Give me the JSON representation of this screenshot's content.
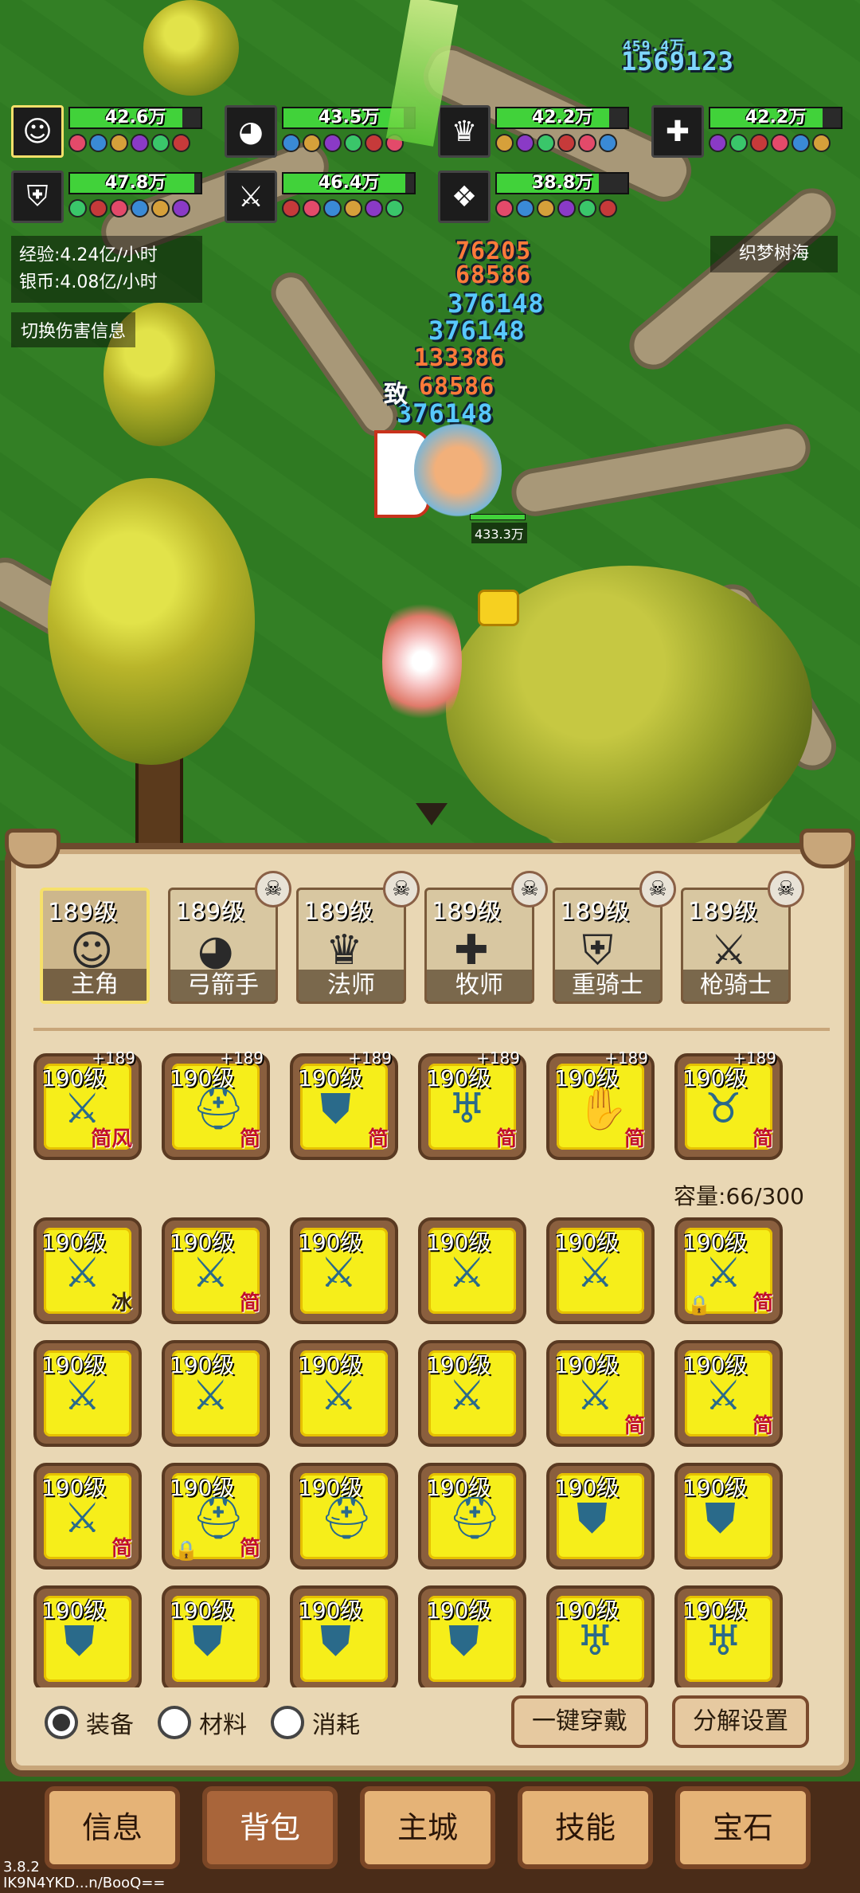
{
  "party": [
    {
      "hp": "42.6万",
      "icon": "hero-icon",
      "glyph": "☺",
      "fill": 0.86,
      "selected": true
    },
    {
      "hp": "43.5万",
      "icon": "archer-icon",
      "glyph": "◕",
      "fill": 0.92,
      "selected": false
    },
    {
      "hp": "42.2万",
      "icon": "mage-icon",
      "glyph": "♛",
      "fill": 0.86,
      "selected": false
    },
    {
      "hp": "42.2万",
      "icon": "priest-icon",
      "glyph": "✚",
      "fill": 0.86,
      "selected": false
    },
    {
      "hp": "47.8万",
      "icon": "heavy-knight-icon",
      "glyph": "⛨",
      "fill": 0.95,
      "selected": false
    },
    {
      "hp": "46.4万",
      "icon": "lance-knight-icon",
      "glyph": "⚔",
      "fill": 0.93,
      "selected": false
    },
    {
      "hp": "38.8万",
      "icon": "pet-icon",
      "glyph": "❖",
      "fill": 0.78,
      "selected": false
    }
  ],
  "stats": {
    "exp_rate": "经验:4.24亿/小时",
    "silver_rate": "银币:4.08亿/小时"
  },
  "switch_damage_label": "切换伤害信息",
  "zone_name": "织梦树海",
  "damage_numbers": [
    "459.4万",
    "1569123",
    "76205",
    "68586",
    "376148",
    "376148",
    "133386",
    "68586",
    "376148"
  ],
  "crit_label": "致",
  "enemy_hp": "433.3万",
  "heroes": [
    {
      "level": "189级",
      "name": "主角",
      "glyph": "☺",
      "active": true
    },
    {
      "level": "189级",
      "name": "弓箭手",
      "glyph": "◕",
      "active": false
    },
    {
      "level": "189级",
      "name": "法师",
      "glyph": "♛",
      "active": false
    },
    {
      "level": "189级",
      "name": "牧师",
      "glyph": "✚",
      "active": false
    },
    {
      "level": "189级",
      "name": "重骑士",
      "glyph": "⛨",
      "active": false
    },
    {
      "level": "189级",
      "name": "枪骑士",
      "glyph": "⚔",
      "active": false
    }
  ],
  "equipped": [
    {
      "level": "190级",
      "plus": "+189",
      "icon": "sword-icon",
      "glyph": "⚔",
      "tag": "简风"
    },
    {
      "level": "190级",
      "plus": "+189",
      "icon": "helmet-icon",
      "glyph": "⛑",
      "tag": "简"
    },
    {
      "level": "190级",
      "plus": "+189",
      "icon": "armor-icon",
      "glyph": "⛊",
      "tag": "简"
    },
    {
      "level": "190级",
      "plus": "+189",
      "icon": "leggings-icon",
      "glyph": "♅",
      "tag": "简"
    },
    {
      "level": "190级",
      "plus": "+189",
      "icon": "gauntlet-icon",
      "glyph": "✋",
      "tag": "简"
    },
    {
      "level": "190级",
      "plus": "+189",
      "icon": "boots-icon",
      "glyph": "♉",
      "tag": "简"
    }
  ],
  "capacity": "容量:66/300",
  "bag": [
    {
      "level": "190级",
      "icon": "sword-icon",
      "glyph": "⚔",
      "tag": "冰",
      "ice": true,
      "lock": false
    },
    {
      "level": "190级",
      "icon": "sword-icon",
      "glyph": "⚔",
      "tag": "简",
      "lock": false
    },
    {
      "level": "190级",
      "icon": "sword-icon",
      "glyph": "⚔",
      "tag": "",
      "lock": false
    },
    {
      "level": "190级",
      "icon": "sword-icon",
      "glyph": "⚔",
      "tag": "",
      "lock": false
    },
    {
      "level": "190级",
      "icon": "sword-icon",
      "glyph": "⚔",
      "tag": "",
      "lock": false
    },
    {
      "level": "190级",
      "icon": "sword-icon",
      "glyph": "⚔",
      "tag": "简",
      "lock": true
    },
    {
      "level": "190级",
      "icon": "sword-icon",
      "glyph": "⚔",
      "tag": "",
      "lock": false
    },
    {
      "level": "190级",
      "icon": "sword-icon",
      "glyph": "⚔",
      "tag": "",
      "lock": false
    },
    {
      "level": "190级",
      "icon": "sword-icon",
      "glyph": "⚔",
      "tag": "",
      "lock": false
    },
    {
      "level": "190级",
      "icon": "sword-icon",
      "glyph": "⚔",
      "tag": "",
      "lock": false
    },
    {
      "level": "190级",
      "icon": "sword-icon",
      "glyph": "⚔",
      "tag": "简",
      "lock": false
    },
    {
      "level": "190级",
      "icon": "sword-icon",
      "glyph": "⚔",
      "tag": "简",
      "lock": false
    },
    {
      "level": "190级",
      "icon": "sword-icon",
      "glyph": "⚔",
      "tag": "简",
      "lock": false
    },
    {
      "level": "190级",
      "icon": "helmet-icon",
      "glyph": "⛑",
      "tag": "简",
      "lock": true
    },
    {
      "level": "190级",
      "icon": "helmet-icon",
      "glyph": "⛑",
      "tag": "",
      "lock": false
    },
    {
      "level": "190级",
      "icon": "helmet-icon",
      "glyph": "⛑",
      "tag": "",
      "lock": false
    },
    {
      "level": "190级",
      "icon": "armor-icon",
      "glyph": "⛊",
      "tag": "",
      "lock": false
    },
    {
      "level": "190级",
      "icon": "armor-icon",
      "glyph": "⛊",
      "tag": "",
      "lock": false
    },
    {
      "level": "190级",
      "icon": "armor-icon",
      "glyph": "⛊",
      "tag": "",
      "lock": false
    },
    {
      "level": "190级",
      "icon": "armor-icon",
      "glyph": "⛊",
      "tag": "",
      "lock": false
    },
    {
      "level": "190级",
      "icon": "armor-icon",
      "glyph": "⛊",
      "tag": "",
      "lock": false
    },
    {
      "level": "190级",
      "icon": "armor-icon",
      "glyph": "⛊",
      "tag": "",
      "lock": false
    },
    {
      "level": "190级",
      "icon": "leggings-icon",
      "glyph": "♅",
      "tag": "",
      "lock": false
    },
    {
      "level": "190级",
      "icon": "leggings-icon",
      "glyph": "♅",
      "tag": "",
      "lock": false
    }
  ],
  "filters": [
    {
      "label": "装备",
      "selected": true
    },
    {
      "label": "材料",
      "selected": false
    },
    {
      "label": "消耗",
      "selected": false
    }
  ],
  "actions": {
    "equip_all": "一键穿戴",
    "dismantle_settings": "分解设置"
  },
  "nav": [
    {
      "label": "信息",
      "active": false
    },
    {
      "label": "背包",
      "active": true
    },
    {
      "label": "主城",
      "active": false
    },
    {
      "label": "技能",
      "active": false
    },
    {
      "label": "宝石",
      "active": false
    }
  ],
  "version": "3.8.2",
  "device_id": "IK9N4YKD...n/BooQ==",
  "colors": {
    "hp_fill": "#41d23a",
    "item_bg": "#f6ee1a",
    "tag_red": "#c0102a",
    "panel_bg": "#e9d7b4"
  }
}
